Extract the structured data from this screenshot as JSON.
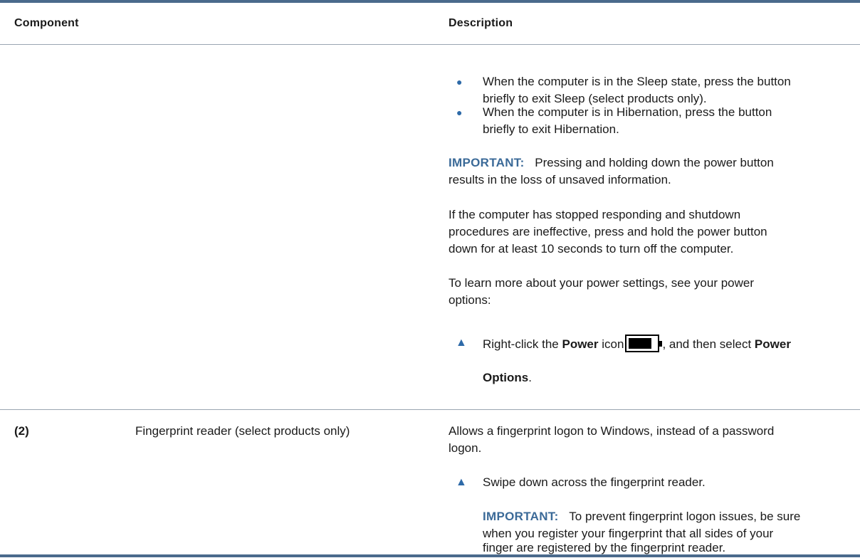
{
  "table": {
    "headers": {
      "component": "Component",
      "description": "Description"
    },
    "power_row": {
      "bullets": [
        {
          "line1": "When the computer is in the Sleep state, press the button",
          "line2": "briefly to exit Sleep (select products only)."
        },
        {
          "line1": "When the computer is in Hibernation, press the button",
          "line2": "briefly to exit Hibernation."
        }
      ],
      "important": {
        "label": "IMPORTANT:",
        "line1": "Pressing and holding down the power button",
        "line2": "results in the loss of unsaved information."
      },
      "paragraph_stopped": {
        "line1": "If the computer has stopped responding and shutdown",
        "line2": "procedures are ineffective, press and hold the power button",
        "line3": "down for at least 10 seconds to turn off the computer."
      },
      "paragraph_learn": {
        "line1": "To learn more about your power settings, see your power",
        "line2": "options:"
      },
      "step": {
        "pre": "Right-click the ",
        "bold1": "Power",
        "mid": " icon",
        "post": ", and then select ",
        "bold2": "Power",
        "bold3": "Options",
        "end": "."
      }
    },
    "fingerprint_row": {
      "number": "(2)",
      "component": "Fingerprint reader (select products only)",
      "desc_line1": "Allows a fingerprint logon to Windows, instead of a password",
      "desc_line2": "logon.",
      "step": "Swipe down across the fingerprint reader.",
      "important": {
        "label": "IMPORTANT:",
        "line1": "To prevent fingerprint logon issues, be sure",
        "line2": "when you register your fingerprint that all sides of your",
        "line3": "finger are registered by the fingerprint reader."
      }
    }
  },
  "icons": {
    "bullet": "●",
    "step": "▲"
  },
  "colors": {
    "rule": "#4a6a8c",
    "accent": "#2e6aa8",
    "important": "#3b6a98"
  }
}
